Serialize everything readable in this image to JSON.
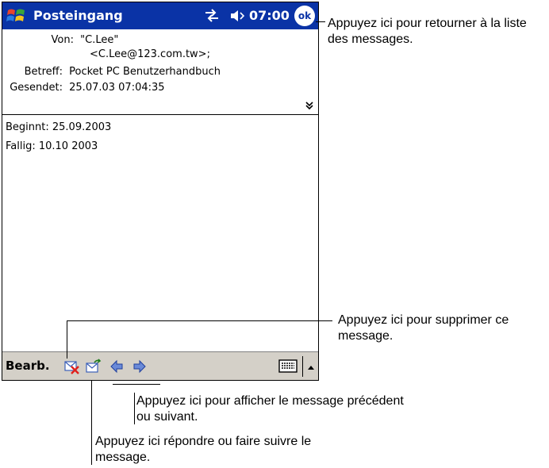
{
  "titlebar": {
    "app_title": "Posteingang",
    "clock": "07:00",
    "ok_label": "ok"
  },
  "header": {
    "from_label": "Von:",
    "from_name": "\"C.Lee\"",
    "from_address": "<C.Lee@123.com.tw>;",
    "subject_label": "Betreff:",
    "subject_value": "Pocket PC Benutzerhandbuch",
    "sent_label": "Gesendet:",
    "sent_value": "25.07.03 07:04:35"
  },
  "body": {
    "line1": "Beginnt: 25.09.2003",
    "line2": "Fallig: 10.10 2003"
  },
  "commandbar": {
    "edit_menu": "Bearb."
  },
  "callouts": {
    "ok": "Appuyez ici pour retourner à la liste des messages.",
    "delete": "Appuyez ici pour supprimer ce message.",
    "prevnext": "Appuyez ici pour afficher le message précédent ou suivant.",
    "reply": "Appuyez ici répondre ou faire suivre le message."
  }
}
